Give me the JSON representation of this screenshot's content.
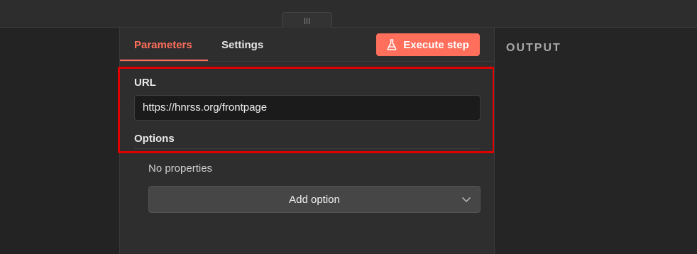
{
  "tabs": {
    "parameters": "Parameters",
    "settings": "Settings"
  },
  "execute_button": {
    "label": "Execute step",
    "icon": "flask-icon"
  },
  "url_field": {
    "label": "URL",
    "value": "https://hnrss.org/frontpage"
  },
  "options": {
    "label": "Options",
    "empty_text": "No properties",
    "add_label": "Add option",
    "add_icon": "chevron-down-icon"
  },
  "output": {
    "title": "OUTPUT"
  },
  "colors": {
    "accent": "#ff6f5c",
    "highlight": "#e00000",
    "panel": "#2e2e2e",
    "input_bg": "#1b1b1b"
  }
}
